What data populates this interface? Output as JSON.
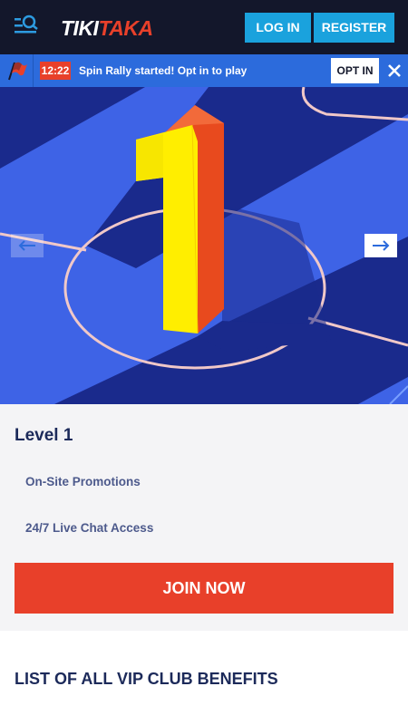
{
  "header": {
    "logo_part1": "TIKI",
    "logo_part2": "TAKA",
    "login_label": "LOG IN",
    "register_label": "REGISTER",
    "menu_icon": "menu-search-icon"
  },
  "notification": {
    "flag_icon": "flag-icon",
    "time": "12:22",
    "message": "Spin Rally started! Opt in to play",
    "opt_in_label": "OPT IN",
    "close_icon": "close-icon"
  },
  "hero": {
    "level_number": "1",
    "prev_icon": "arrow-left-icon",
    "next_icon": "arrow-right-icon"
  },
  "level": {
    "title": "Level 1",
    "benefits": [
      "On-Site Promotions",
      "24/7 Live Chat Access"
    ],
    "join_label": "JOIN NOW"
  },
  "vip": {
    "heading": "LIST OF ALL VIP CLUB BENEFITS"
  },
  "colors": {
    "header_bg": "#13172b",
    "accent_blue": "#1aa2dd",
    "notification_bg": "#2c6bdc",
    "accent_red": "#e8402a",
    "hero_blue": "#3e63e6",
    "text_navy": "#1c2a5a"
  }
}
